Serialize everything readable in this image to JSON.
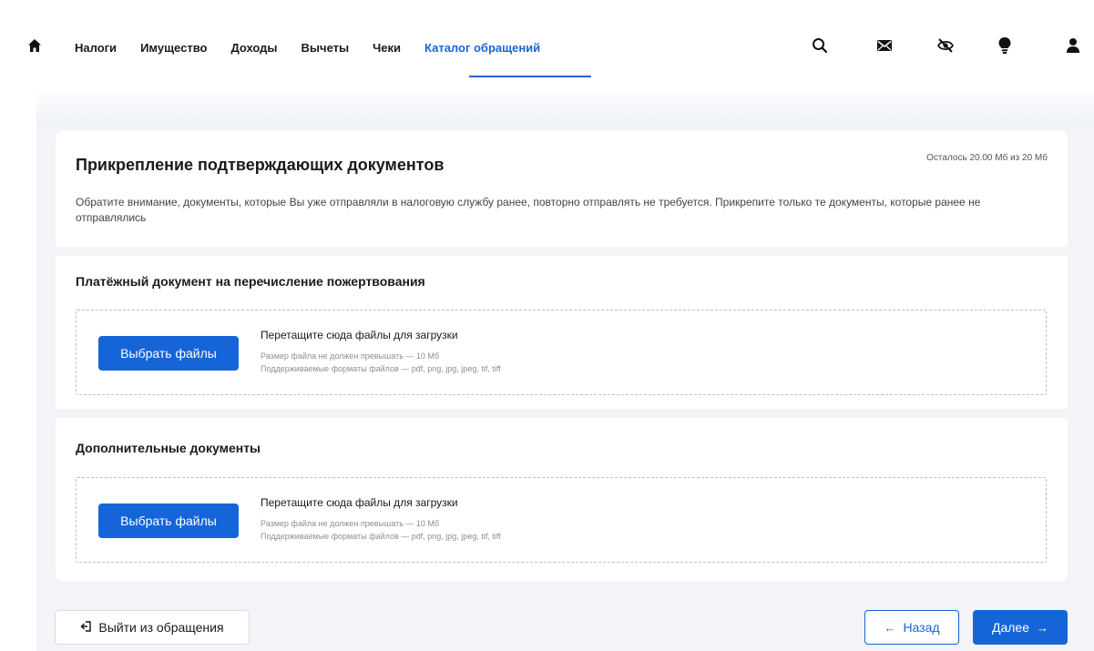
{
  "nav": {
    "items": [
      {
        "label": "Налоги"
      },
      {
        "label": "Имущество"
      },
      {
        "label": "Доходы"
      },
      {
        "label": "Вычеты"
      },
      {
        "label": "Чеки"
      },
      {
        "label": "Каталог обращений"
      }
    ],
    "active_index": 5,
    "icons": [
      "home-icon",
      "search-icon",
      "mail-icon",
      "eye-off-icon",
      "lightbulb-icon",
      "user-icon"
    ]
  },
  "card": {
    "title": "Прикрепление подтверждающих документов",
    "quota": "Осталось 20.00 Мб из 20 Мб",
    "notice": "Обратите внимание, документы, которые Вы уже отправляли в налоговую службу ранее, повторно отправлять не требуется. Прикрепите только те документы, которые ранее не отправлялись"
  },
  "sections": [
    {
      "title": "Платёжный документ на перечисление пожертвования",
      "button_label": "Выбрать файлы",
      "drop_title": "Перетащите сюда файлы для загрузки",
      "size_hint": "Размер файла не должен превышать — 10 Мб",
      "formats_hint": "Поддерживаемые форматы файлов — pdf, png, jpg, jpeg, tif, tiff"
    },
    {
      "title": "Дополнительные документы",
      "button_label": "Выбрать файлы",
      "drop_title": "Перетащите сюда файлы для загрузки",
      "size_hint": "Размер файла не должен превышать — 10 Мб",
      "formats_hint": "Поддерживаемые форматы файлов — pdf, png, jpg, jpeg, tif, tiff"
    }
  ],
  "footer": {
    "exit_label": "Выйти из обращения",
    "back_label": "Назад",
    "next_label": "Далее"
  },
  "colors": {
    "accent": "#1565d8",
    "page_bg": "#f2f4f7"
  }
}
